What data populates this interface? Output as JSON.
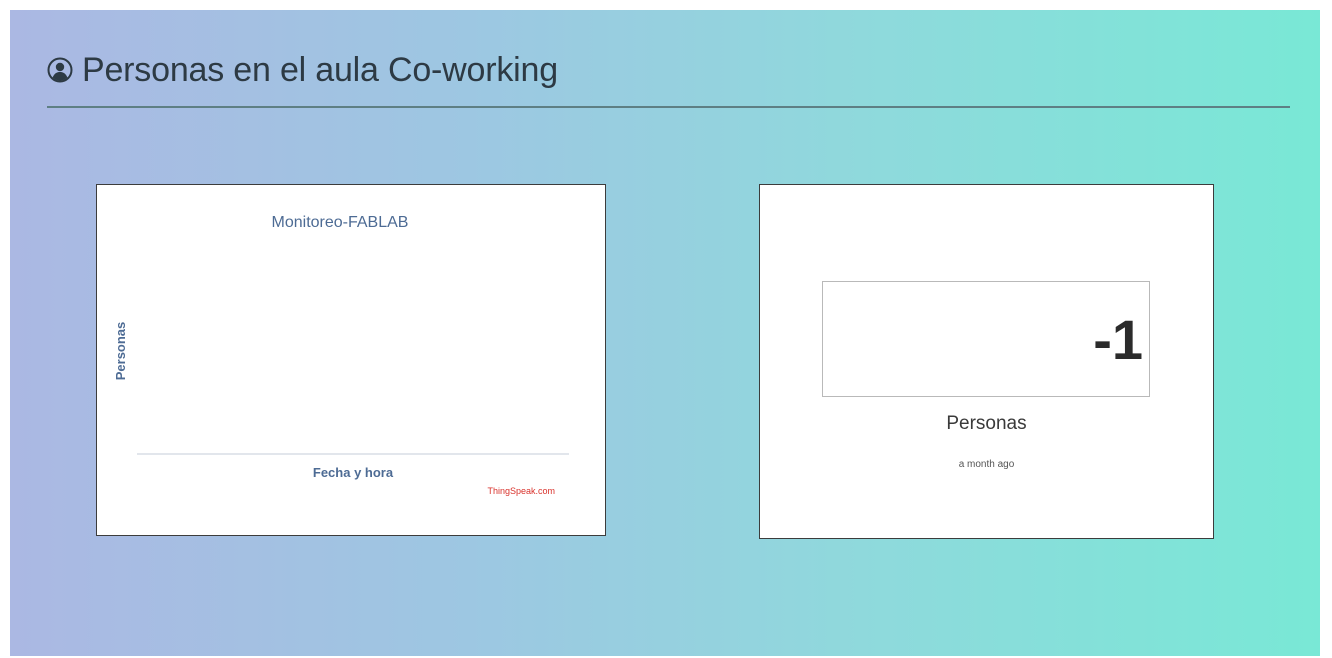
{
  "header": {
    "title": "Personas en el aula Co-working",
    "icon": "user-circle-icon"
  },
  "chart_widget": {
    "credit": "ThingSpeak.com",
    "credit_color": "#d9322c",
    "text_color": "#4d6b94"
  },
  "chart_data": {
    "type": "line",
    "title": "Monitoreo-FABLAB",
    "xlabel": "Fecha y hora",
    "ylabel": "Personas",
    "series": []
  },
  "value_widget": {
    "value": "-1",
    "label": "Personas",
    "updated": "a month ago"
  },
  "colors": {
    "gradient_start": "#abb8e3",
    "gradient_end": "#79e8d6",
    "header_rule": "#5e7f84"
  }
}
